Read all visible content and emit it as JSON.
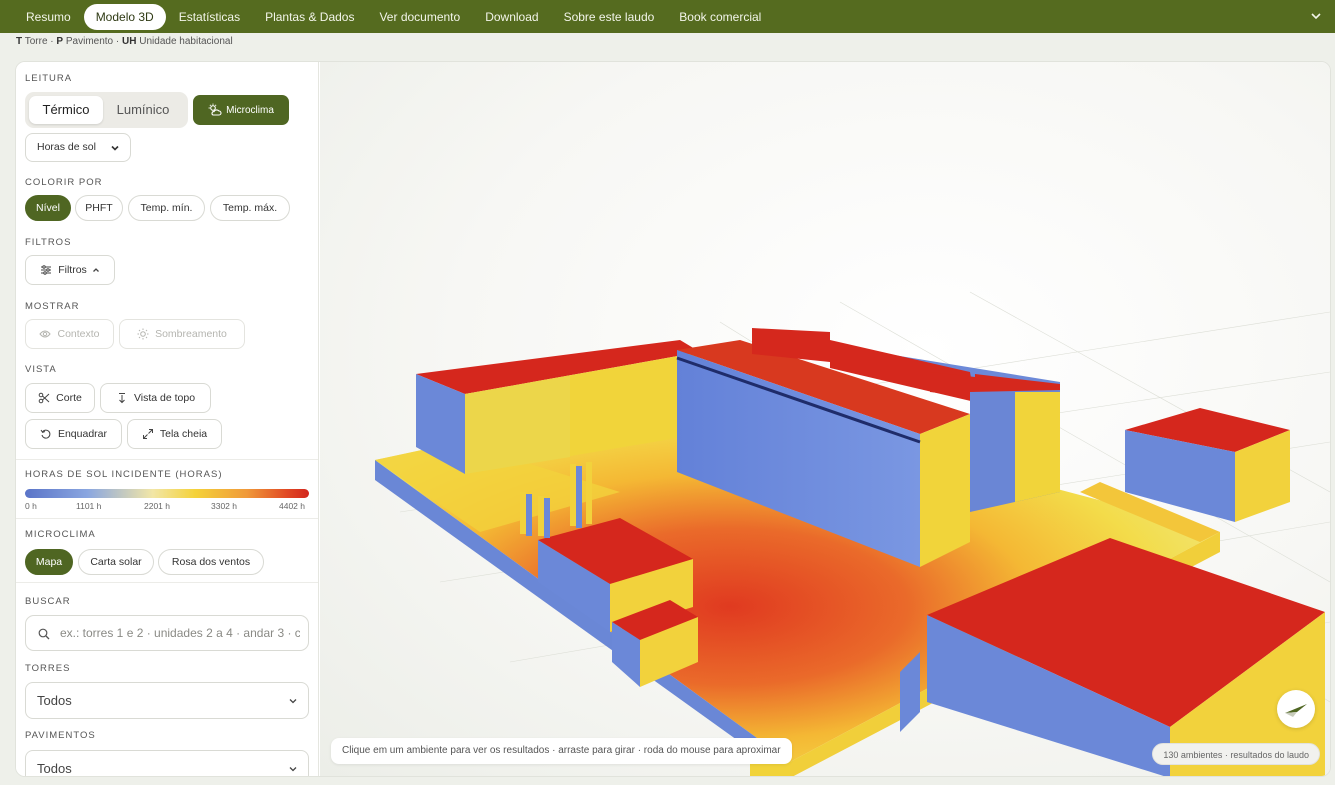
{
  "nav": {
    "tabs": [
      {
        "label": "Resumo"
      },
      {
        "label": "Modelo 3D"
      },
      {
        "label": "Estatísticas"
      },
      {
        "label": "Plantas & Dados"
      },
      {
        "label": "Ver documento"
      },
      {
        "label": "Download"
      },
      {
        "label": "Sobre este laudo"
      },
      {
        "label": "Book comercial"
      }
    ],
    "active_tab": "Modelo 3D"
  },
  "legend": {
    "t_key": "T",
    "t_label": "Torre",
    "p_key": "P",
    "p_label": "Pavimento",
    "uh_key": "UH",
    "uh_label": "Unidade habitacional",
    "separator": "·"
  },
  "sidebar": {
    "leitura": {
      "label": "LEITURA",
      "termico": "Térmico",
      "luminico": "Lumínico",
      "microclima": "Microclima",
      "select_value": "Horas de sol"
    },
    "colorir": {
      "label": "COLORIR POR",
      "options": [
        "Nível",
        "PHFT",
        "Temp. mín.",
        "Temp. máx."
      ],
      "selected": "Nível"
    },
    "filtros": {
      "label": "FILTROS",
      "button": "Filtros"
    },
    "mostrar": {
      "label": "MOSTRAR",
      "contexto": "Contexto",
      "sombreamento": "Sombreamento"
    },
    "vista": {
      "label": "VISTA",
      "corte": "Corte",
      "topo": "Vista de topo",
      "enquadrar": "Enquadrar",
      "tela_cheia": "Tela cheia"
    },
    "horas": {
      "label": "HORAS DE SOL INCIDENTE (HORAS)",
      "ticks": [
        "0 h",
        "1101 h",
        "2201 h",
        "3302 h",
        "4402 h"
      ],
      "min": 0,
      "max": 4402
    },
    "microclima": {
      "label": "MICROCLIMA",
      "options": [
        "Mapa",
        "Carta solar",
        "Rosa dos ventos"
      ],
      "selected": "Mapa"
    },
    "buscar": {
      "label": "BUSCAR",
      "placeholder": "ex.: torres 1 e 2 · unidades 2 a 4 · andar 3 · c"
    },
    "torres": {
      "label": "TORRES",
      "value": "Todos"
    },
    "pavimentos": {
      "label": "PAVIMENTOS",
      "value": "Todos"
    }
  },
  "viewport": {
    "hint": "Clique em um ambiente para ver os resultados · arraste para girar · roda do mouse para aproximar",
    "count": "130 ambientes · resultados do laudo"
  },
  "colors": {
    "brand": "#556b1f",
    "accent": "#4f6622",
    "heat_low": "#6b86d6",
    "heat_mid": "#f1d33a",
    "heat_high": "#d3261e"
  }
}
